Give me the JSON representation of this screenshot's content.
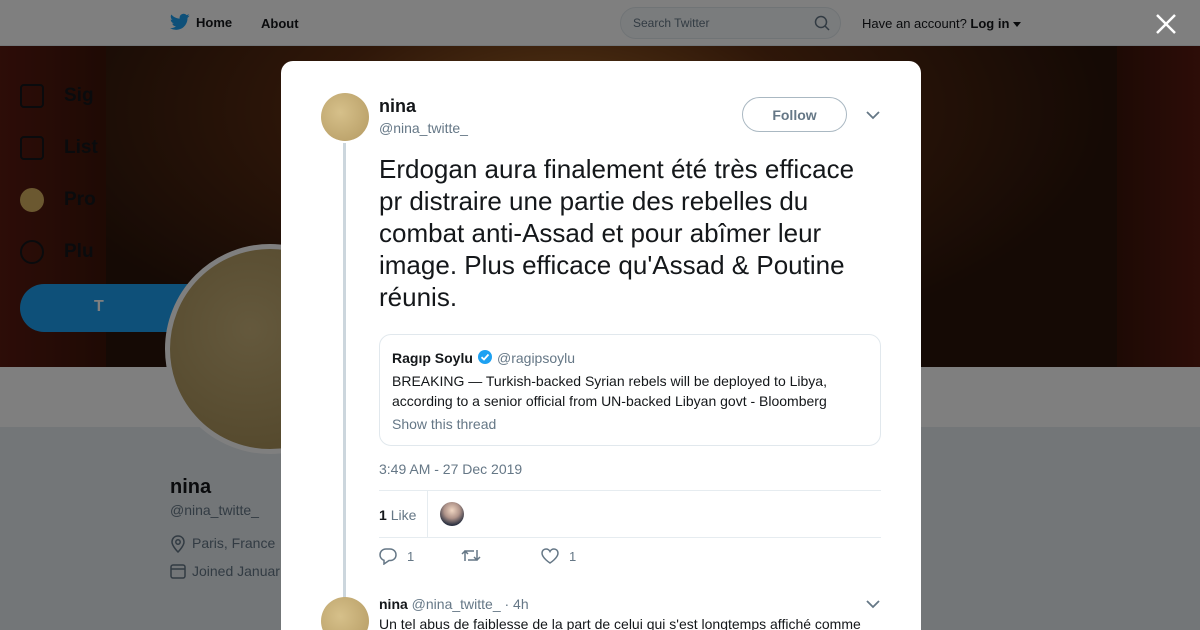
{
  "nav": {
    "home_label": "Home",
    "about_label": "About",
    "search_placeholder": "Search Twitter",
    "account_prompt": "Have an account?",
    "login_label": "Log in"
  },
  "colors": {
    "brand": "#1da1f2",
    "text_primary": "#14171a",
    "text_secondary": "#657786",
    "verified": "#1da1f2"
  },
  "background_profile": {
    "menu": [
      {
        "label": "Sig",
        "icon": "bookmark-icon"
      },
      {
        "label": "List",
        "icon": "list-icon"
      },
      {
        "label": "Pro",
        "icon": "profile-icon"
      },
      {
        "label": "Plu",
        "icon": "more-icon"
      }
    ],
    "tweet_button_label": "T",
    "name": "nina",
    "handle": "@nina_twitte_",
    "location": "Paris, France",
    "joined": "Joined Januar"
  },
  "tweet": {
    "author_name": "nina",
    "author_handle": "@nina_twitte_",
    "follow_label": "Follow",
    "text": "Erdogan aura finalement été très efficace pr distraire une partie des rebelles du combat anti-Assad et pour abîmer leur image. Plus efficace qu'Assad & Poutine réunis.",
    "quoted": {
      "name": "Ragıp Soylu",
      "handle": "@ragipsoylu",
      "text": "BREAKING —  Turkish-backed Syrian rebels will be deployed to Libya, according to a senior official from UN-backed Libyan govt  - Bloomberg",
      "show_thread_label": "Show this thread"
    },
    "timestamp": "3:49 AM - 27 Dec 2019",
    "likes_count": "1",
    "likes_label": "Like",
    "reply_count": "1",
    "like_action_count": "1"
  },
  "reply": {
    "name": "nina",
    "handle": "@nina_twitte_",
    "time": "· 4h",
    "text": "Un tel abus de faiblesse de la part de celui qui s'est longtemps affiché comme"
  }
}
